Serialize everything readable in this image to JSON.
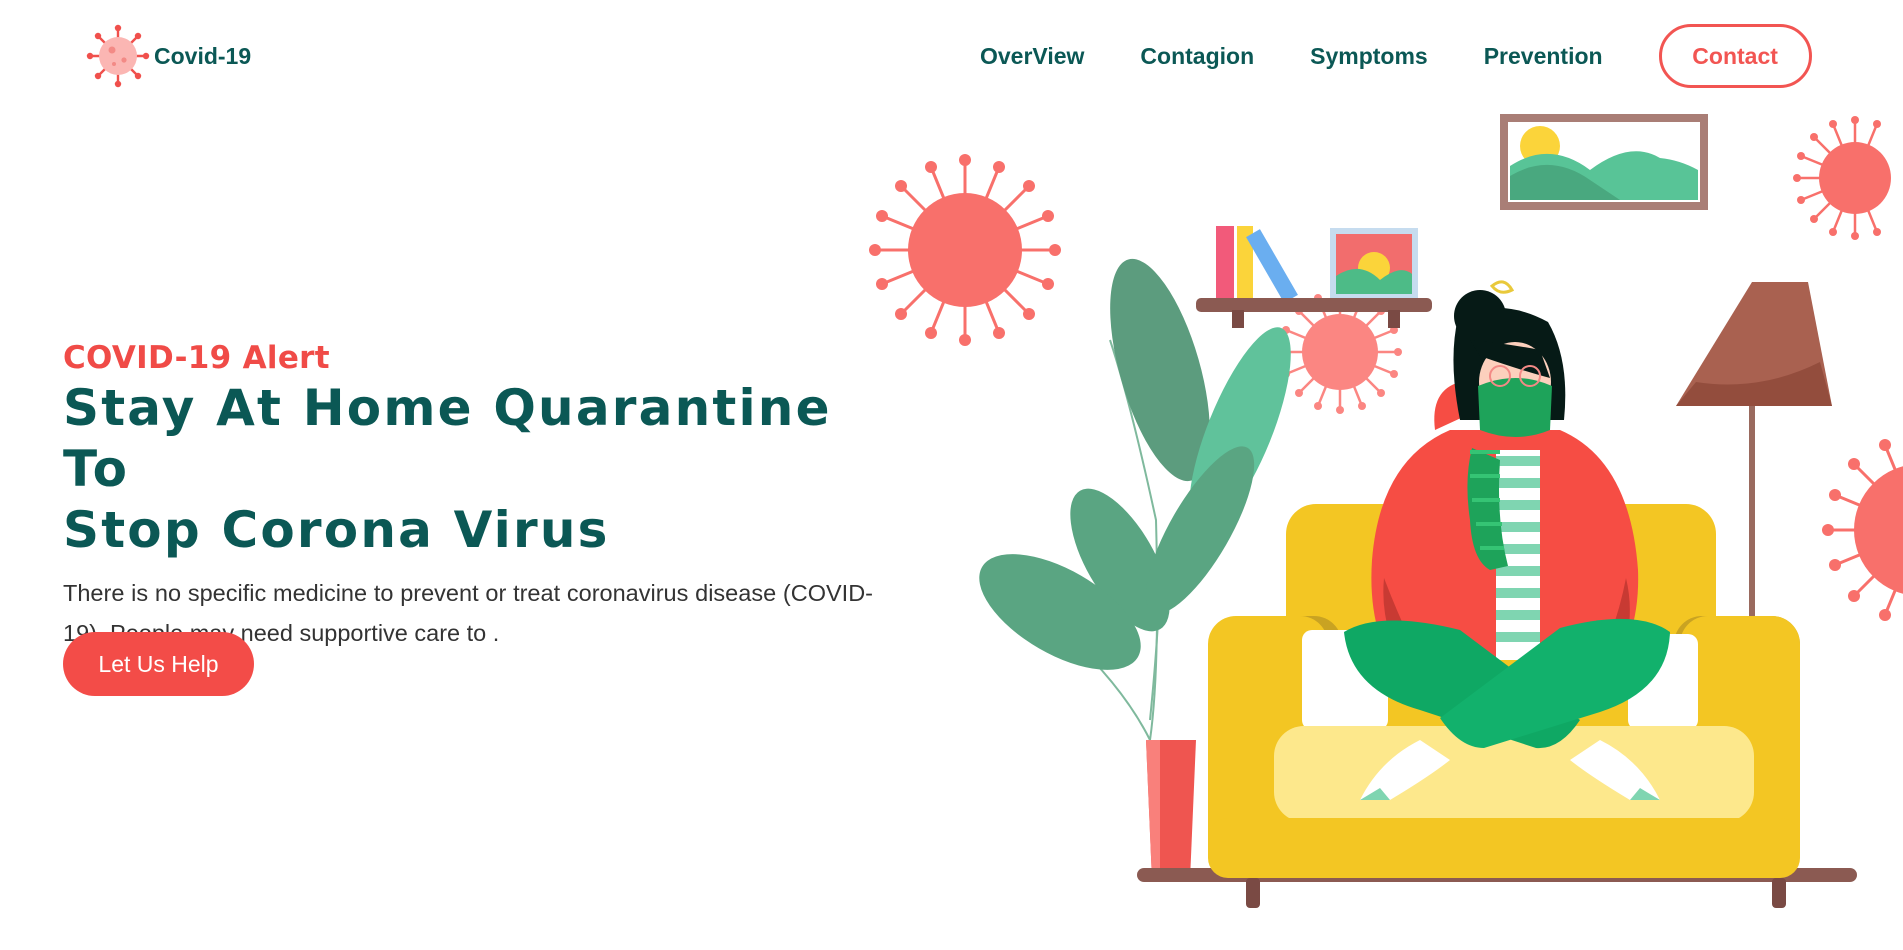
{
  "header": {
    "logo_text": "Covid-19",
    "nav": [
      "OverView",
      "Contagion",
      "Symptoms",
      "Prevention"
    ],
    "contact_label": "Contact"
  },
  "hero": {
    "alert": "COVID-19 Alert",
    "title_line1": "Stay At Home Quarantine To",
    "title_line2": "Stop Corona Virus",
    "description": "There is no specific medicine to prevent or treat coronavirus disease (COVID-19). People may need supportive care to .",
    "cta_label": "Let Us Help"
  },
  "colors": {
    "brand_dark": "#0b5855",
    "accent_red": "#f25552",
    "virus": "#f8706b",
    "sofa": "#f3c623",
    "leaf": "#5aa582"
  },
  "icons": {
    "logo": "virus-icon"
  }
}
